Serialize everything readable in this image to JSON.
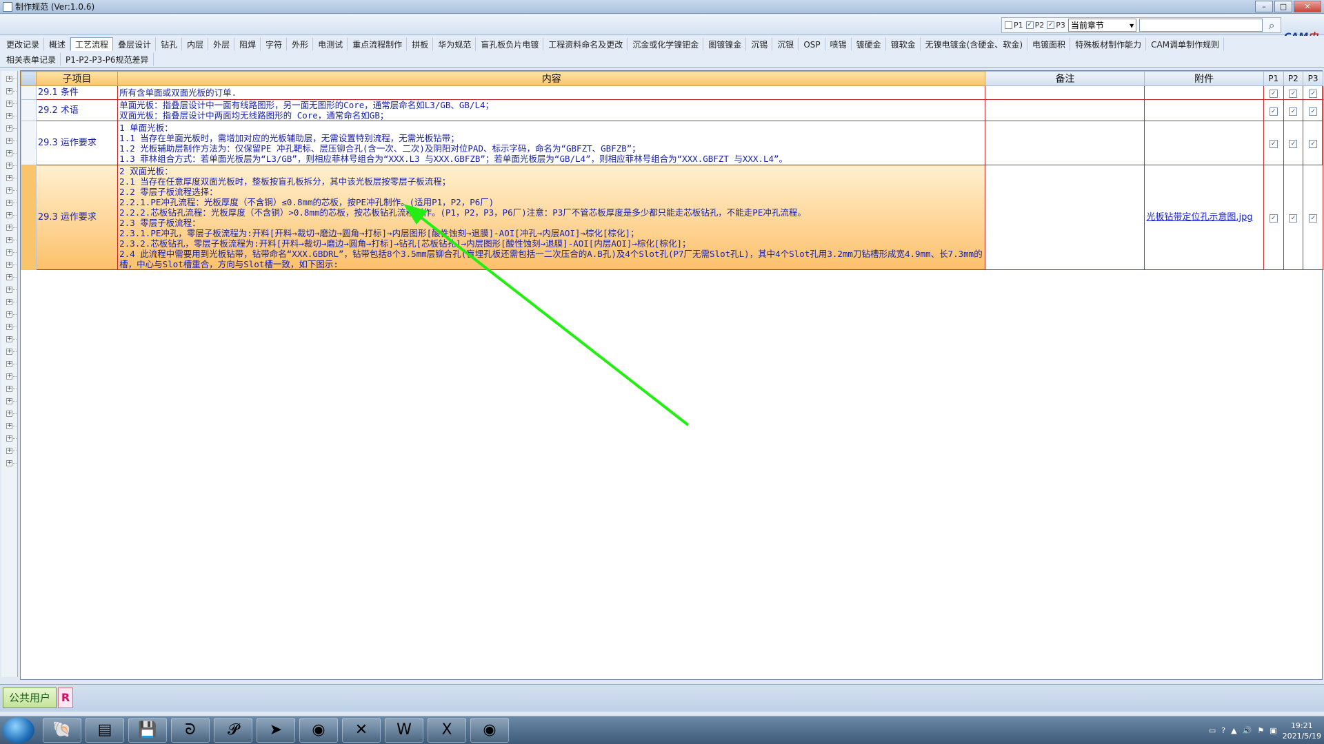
{
  "window": {
    "title": "制作规范 (Ver:1.0.6)"
  },
  "toolbar": {
    "filters": [
      {
        "label": "P1",
        "checked": false
      },
      {
        "label": "P2",
        "checked": true
      },
      {
        "label": "P3",
        "checked": true
      }
    ],
    "scope_value": "当前章节",
    "search_placeholder": "",
    "logo_a": "CAM",
    "logo_b": "中心"
  },
  "tabs_row1": [
    "更改记录",
    "概述",
    "工艺流程",
    "叠层设计",
    "钻孔",
    "内层",
    "外层",
    "阻焊",
    "字符",
    "外形",
    "电测试",
    "重点流程制作",
    "拼板",
    "华为规范",
    "盲孔板负片电镀",
    "工程资料命名及更改",
    "沉金或化学镍钯金",
    "图镀镍金",
    "沉锡",
    "沉银",
    "OSP",
    "喷锡",
    "镀硬金",
    "镀软金",
    "无镍电镀金(含硬金、软金)",
    "电镀面积",
    "特殊板材制作能力",
    "CAM调单制作规则"
  ],
  "tabs_row2": [
    "相关表单记录",
    "P1-P2-P3-P6规范差异"
  ],
  "active_tab": "工艺流程",
  "grid": {
    "headers": {
      "sub": "子项目",
      "content": "内容",
      "remark": "备注",
      "attachment": "附件",
      "p1": "P1",
      "p2": "P2",
      "p3": "P3"
    },
    "rows": [
      {
        "sub": "29.1 条件",
        "content": "所有含单面或双面光板的订单.",
        "remark": "",
        "attachment": "",
        "p1": true,
        "p2": true,
        "p3": true
      },
      {
        "sub": "29.2 术语",
        "content": "单面光板：指叠层设计中一面有线路图形，另一面无图形的Core，通常层命名如L3/GB、GB/L4；\n双面光板：指叠层设计中两面均无线路图形的 Core，通常命名如GB；",
        "remark": "",
        "attachment": "",
        "p1": true,
        "p2": true,
        "p3": true
      },
      {
        "sub": "29.3 运作要求",
        "content": "1 单面光板：\n1.1 当存在单面光板时，需增加对应的光板辅助层，无需设置特别流程，无需光板钻带；\n1.2 光板辅助层制作方法为：仅保留PE 冲孔靶标、层压铆合孔(含一次、二次)及阴阳对位PAD、标示字码，命名为“GBFZT、GBFZB”；\n1.3 菲林组合方式：若单面光板层为“L3/GB”，则相应菲林号组合为“XXX.L3 与XXX.GBFZB”；若单面光板层为“GB/L4”，则相应菲林号组合为“XXX.GBFZT 与XXX.L4”。",
        "remark": "",
        "attachment": "",
        "p1": true,
        "p2": true,
        "p3": true
      },
      {
        "sub": "29.3 运作要求",
        "content": "2 双面光板：\n2.1 当存在任意厚度双面光板时，整板按盲孔板拆分，其中该光板层按零层子板流程；\n2.2 零层子板流程选择：\n2.2.1.PE冲孔流程：光板厚度（不含铜）≤0.8mm的芯板，按PE冲孔制作。(适用P1，P2，P6厂)\n2.2.2.芯板钻孔流程：光板厚度（不含铜）>0.8mm的芯板，按芯板钻孔流程制作。(P1，P2，P3，P6厂)注意：P3厂不管芯板厚度是多少都只能走芯板钻孔，不能走PE冲孔流程。\n2.3 零层子板流程：\n2.3.1.PE冲孔，零层子板流程为:开料[开料→裁切→磨边→圆角→打标]→内层图形[酸性蚀刻→退膜]-AOI[冲孔→内层AOI]→棕化[棕化]；\n2.3.2.芯板钻孔，零层子板流程为:开料[开料→裁切→磨边→圆角→打标]→钻孔[芯板钻孔]→内层图形[酸性蚀刻→退膜]-AOI[内层AOI]→棕化[棕化]；\n2.4 此流程中需要用到光板钻带，钻带命名“XXX.GBDRL”，钻带包括8个3.5mm层铆合孔(盲埋孔板还需包括一二次压合的A.B孔)及4个Slot孔(P7厂无需Slot孔L)，其中4个Slot孔用3.2mm刀钻槽形成宽4.9mm、长7.3mm的槽，中心与Slot槽重合，方向与Slot槽一致，如下图示:",
        "remark": "",
        "attachment": "光板钻带定位孔示意图.jpg",
        "p1": true,
        "p2": true,
        "p3": true
      }
    ]
  },
  "status": {
    "user": "公共用户",
    "badge": "R"
  },
  "taskbar": {
    "apps": [
      "shell-app-icon",
      "notepad-icon",
      "save-disk-icon",
      "swirl-app-icon",
      "pen-app-icon",
      "chat-bird-icon",
      "eye-app-icon",
      "cross-app-icon",
      "word-icon",
      "excel-icon",
      "eye-app-icon-2"
    ],
    "time": "19:21",
    "date": "2021/5/19"
  },
  "colors": {
    "accent_row": "#fcc06a",
    "text_blue": "#1a22a8",
    "row_border": "#c62b2b",
    "arrow": "#22ee11"
  }
}
